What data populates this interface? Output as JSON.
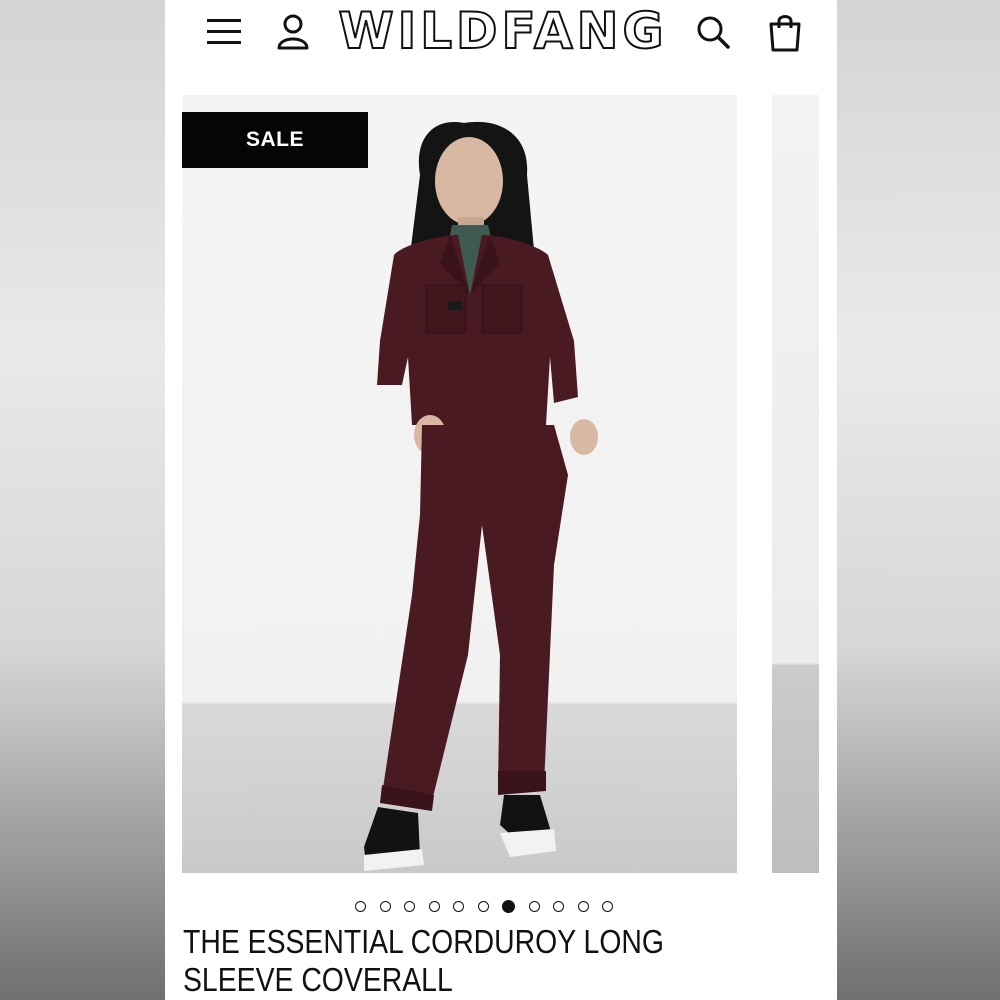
{
  "header": {
    "brand": "WILDFANG",
    "icons": [
      "menu-icon",
      "account-icon",
      "search-icon",
      "shopping-bag-icon"
    ]
  },
  "product": {
    "badge": "SALE",
    "title": "THE ESSENTIAL CORDUROY LONG SLEEVE COVERALL",
    "image_count": 11,
    "active_image": 7
  },
  "colors": {
    "accent": "#050505",
    "garment": "#4a1a22",
    "background": "#ffffff"
  }
}
